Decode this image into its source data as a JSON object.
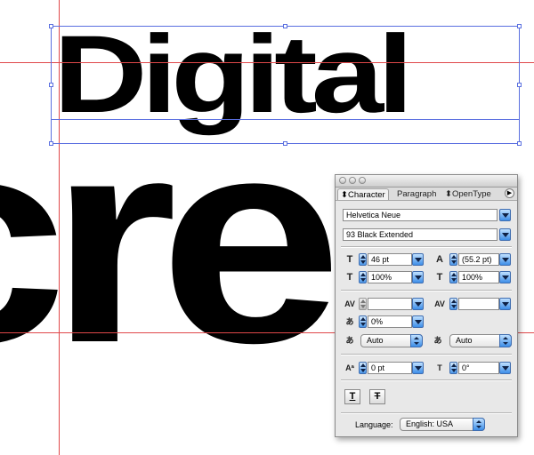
{
  "canvas": {
    "word_top": "Digital",
    "word_bottom": "cree"
  },
  "palette": {
    "tabs": [
      {
        "label": "Character",
        "active": true
      },
      {
        "label": "Paragraph",
        "active": false
      },
      {
        "label": "OpenType",
        "active": false
      }
    ],
    "font_family": "Helvetica Neue",
    "font_style": "93 Black Extended",
    "font_size": "46 pt",
    "leading": "(55.2 pt)",
    "vertical_scale": "100%",
    "horizontal_scale": "100%",
    "kerning": "",
    "tracking": "",
    "char_rotation_pct": "0%",
    "aki_left": "Auto",
    "aki_right": "Auto",
    "baseline_shift": "0 pt",
    "character_rotation": "0°",
    "language_label": "Language:",
    "language_value": "English: USA"
  },
  "colors": {
    "guide": "#e0484a",
    "selection": "#5a6fe0",
    "aqua_blue": "#3d8ee8"
  }
}
